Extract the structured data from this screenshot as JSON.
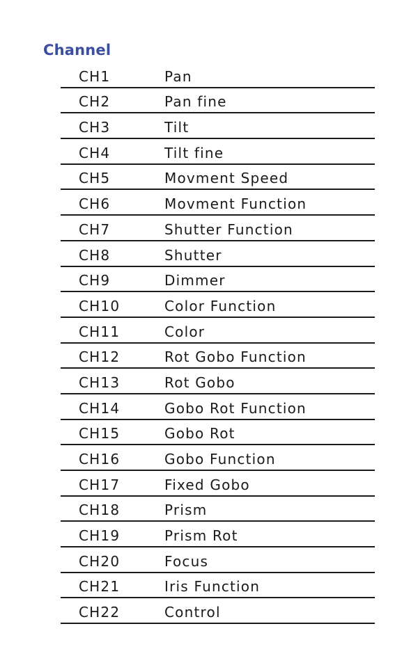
{
  "title": "Channel",
  "rows": [
    {
      "ch": "CH1",
      "fn": "Pan"
    },
    {
      "ch": "CH2",
      "fn": "Pan fine"
    },
    {
      "ch": "CH3",
      "fn": "Tilt"
    },
    {
      "ch": "CH4",
      "fn": "Tilt fine"
    },
    {
      "ch": "CH5",
      "fn": "Movment Speed"
    },
    {
      "ch": "CH6",
      "fn": "Movment Function"
    },
    {
      "ch": "CH7",
      "fn": "Shutter Function"
    },
    {
      "ch": "CH8",
      "fn": "Shutter"
    },
    {
      "ch": "CH9",
      "fn": "Dimmer"
    },
    {
      "ch": "CH10",
      "fn": "Color Function"
    },
    {
      "ch": "CH11",
      "fn": "Color"
    },
    {
      "ch": "CH12",
      "fn": "Rot Gobo Function"
    },
    {
      "ch": "CH13",
      "fn": "Rot Gobo"
    },
    {
      "ch": "CH14",
      "fn": "Gobo Rot Function"
    },
    {
      "ch": "CH15",
      "fn": "Gobo Rot"
    },
    {
      "ch": "CH16",
      "fn": "Gobo Function"
    },
    {
      "ch": "CH17",
      "fn": "Fixed Gobo"
    },
    {
      "ch": "CH18",
      "fn": "Prism"
    },
    {
      "ch": "CH19",
      "fn": "Prism Rot"
    },
    {
      "ch": "CH20",
      "fn": "Focus"
    },
    {
      "ch": "CH21",
      "fn": "Iris Function"
    },
    {
      "ch": "CH22",
      "fn": "Control"
    }
  ]
}
